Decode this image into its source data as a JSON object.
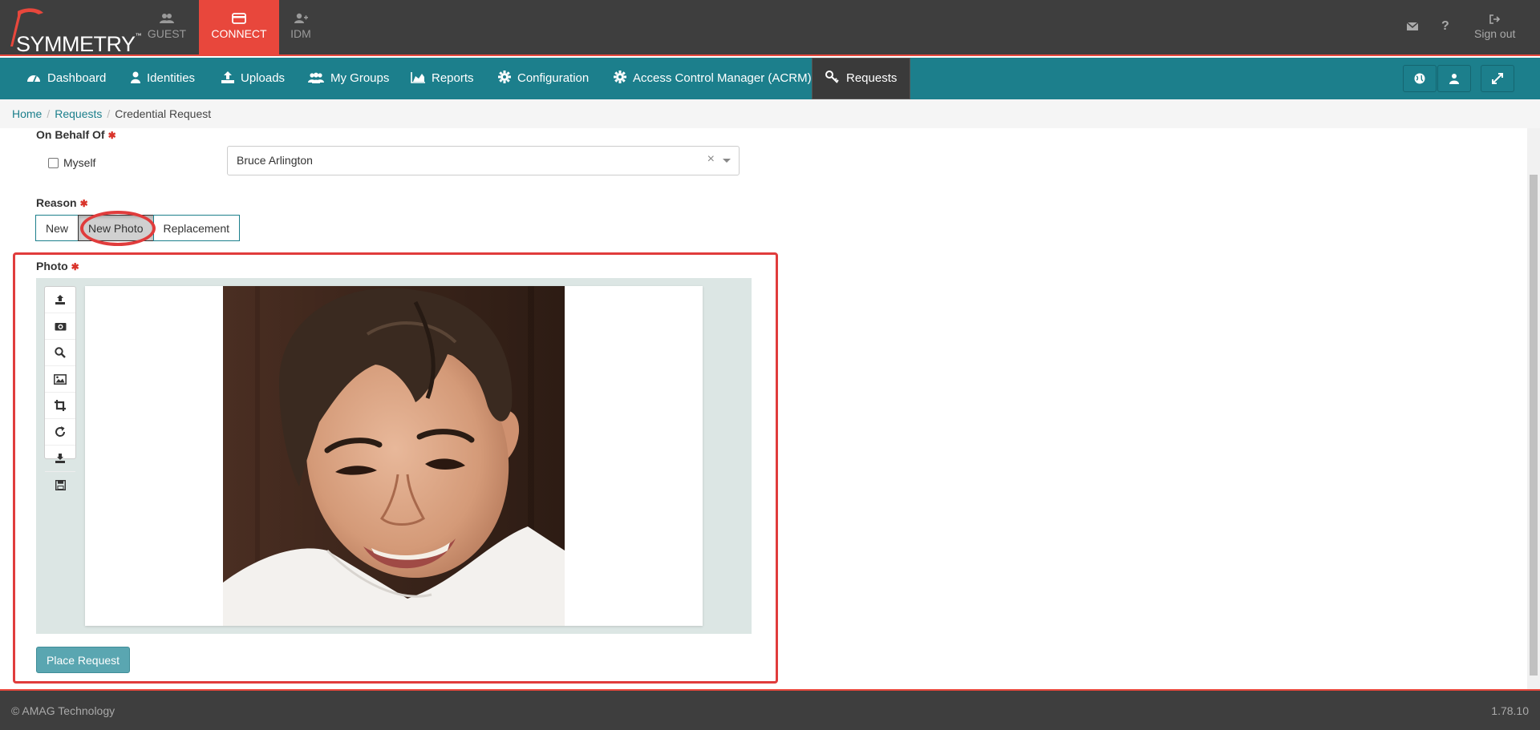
{
  "topbar": {
    "logo_text": "SYMMETRY",
    "logo_tm": "™",
    "apps": [
      {
        "label": "GUEST",
        "icon": "group-icon"
      },
      {
        "label": "CONNECT",
        "icon": "card-icon"
      },
      {
        "label": "IDM",
        "icon": "user-add-icon"
      }
    ],
    "signout_label": "Sign out"
  },
  "nav": {
    "items": [
      {
        "label": "Dashboard",
        "icon": "dashboard-icon"
      },
      {
        "label": "Identities",
        "icon": "user-icon"
      },
      {
        "label": "Uploads",
        "icon": "upload-icon"
      },
      {
        "label": "My Groups",
        "icon": "group-icon"
      },
      {
        "label": "Reports",
        "icon": "area-chart-icon"
      },
      {
        "label": "Configuration",
        "icon": "gear-icon"
      },
      {
        "label": "Access Control Manager (ACRM)",
        "icon": "gear-icon"
      },
      {
        "label": "Requests",
        "icon": "key-icon"
      }
    ]
  },
  "breadcrumb": {
    "items": [
      "Home",
      "Requests"
    ],
    "current": "Credential Request"
  },
  "form": {
    "on_behalf_label": "On Behalf Of",
    "required_mark": "✱",
    "myself_label": "Myself",
    "on_behalf_value": "Bruce Arlington",
    "reason_label": "Reason",
    "reason_options": [
      "New",
      "New Photo",
      "Replacement"
    ],
    "reason_selected": "New Photo",
    "photo_label": "Photo",
    "place_request_label": "Place Request"
  },
  "footer": {
    "copyright": "© AMAG Technology",
    "version": "1.78.10"
  },
  "colors": {
    "accent": "#e8473c",
    "nav": "#1c7f8c",
    "dark": "#3e3e3e",
    "highlight": "#e03c3c"
  }
}
